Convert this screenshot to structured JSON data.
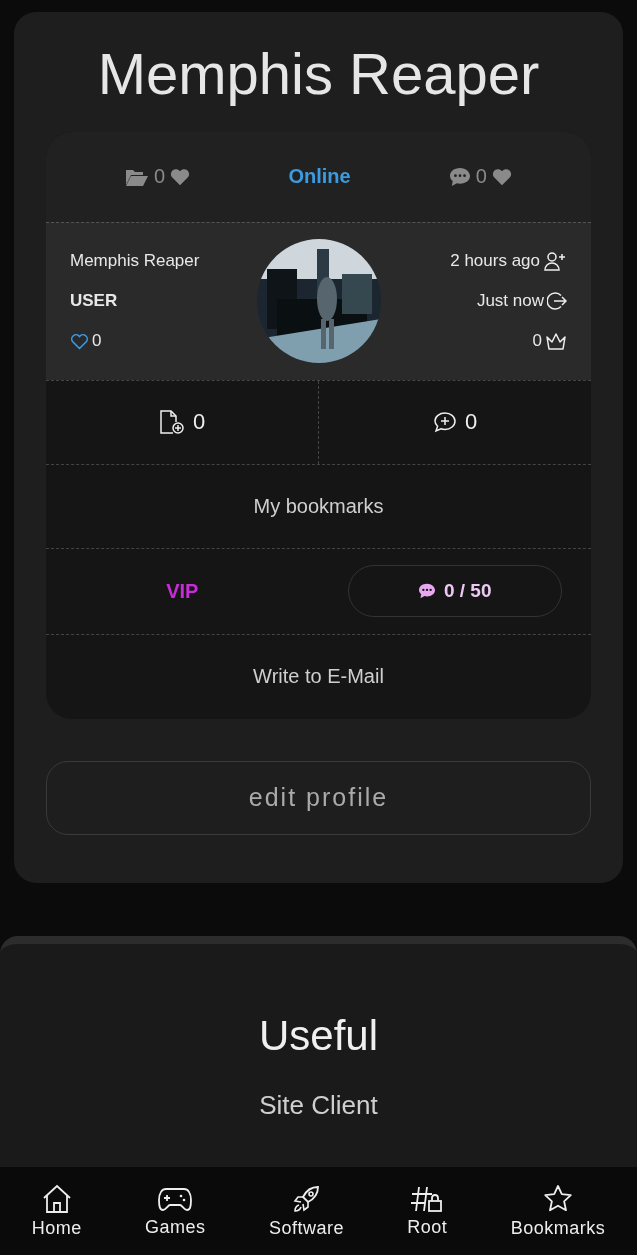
{
  "profile": {
    "title": "Memphis Reaper",
    "stats_top": {
      "files": "0",
      "status": "Online",
      "comments": "0"
    },
    "info": {
      "name": "Memphis Reaper",
      "role": "USER",
      "likes": "0",
      "registered": "2 hours ago",
      "last_visit": "Just now",
      "crowns": "0"
    },
    "counts": {
      "uploads": "0",
      "comments": "0"
    },
    "bookmarks_link": "My bookmarks",
    "vip": {
      "label": "VIP",
      "messages": "0 / 50"
    },
    "email_link": "Write to E-Mail",
    "edit_button": "edit profile"
  },
  "useful": {
    "title": "Useful",
    "links": [
      "Site Client"
    ]
  },
  "nav": [
    {
      "kind": "home",
      "label": "Home"
    },
    {
      "kind": "games",
      "label": "Games"
    },
    {
      "kind": "software",
      "label": "Software"
    },
    {
      "kind": "root",
      "label": "Root"
    },
    {
      "kind": "bookmarks",
      "label": "Bookmarks"
    }
  ]
}
